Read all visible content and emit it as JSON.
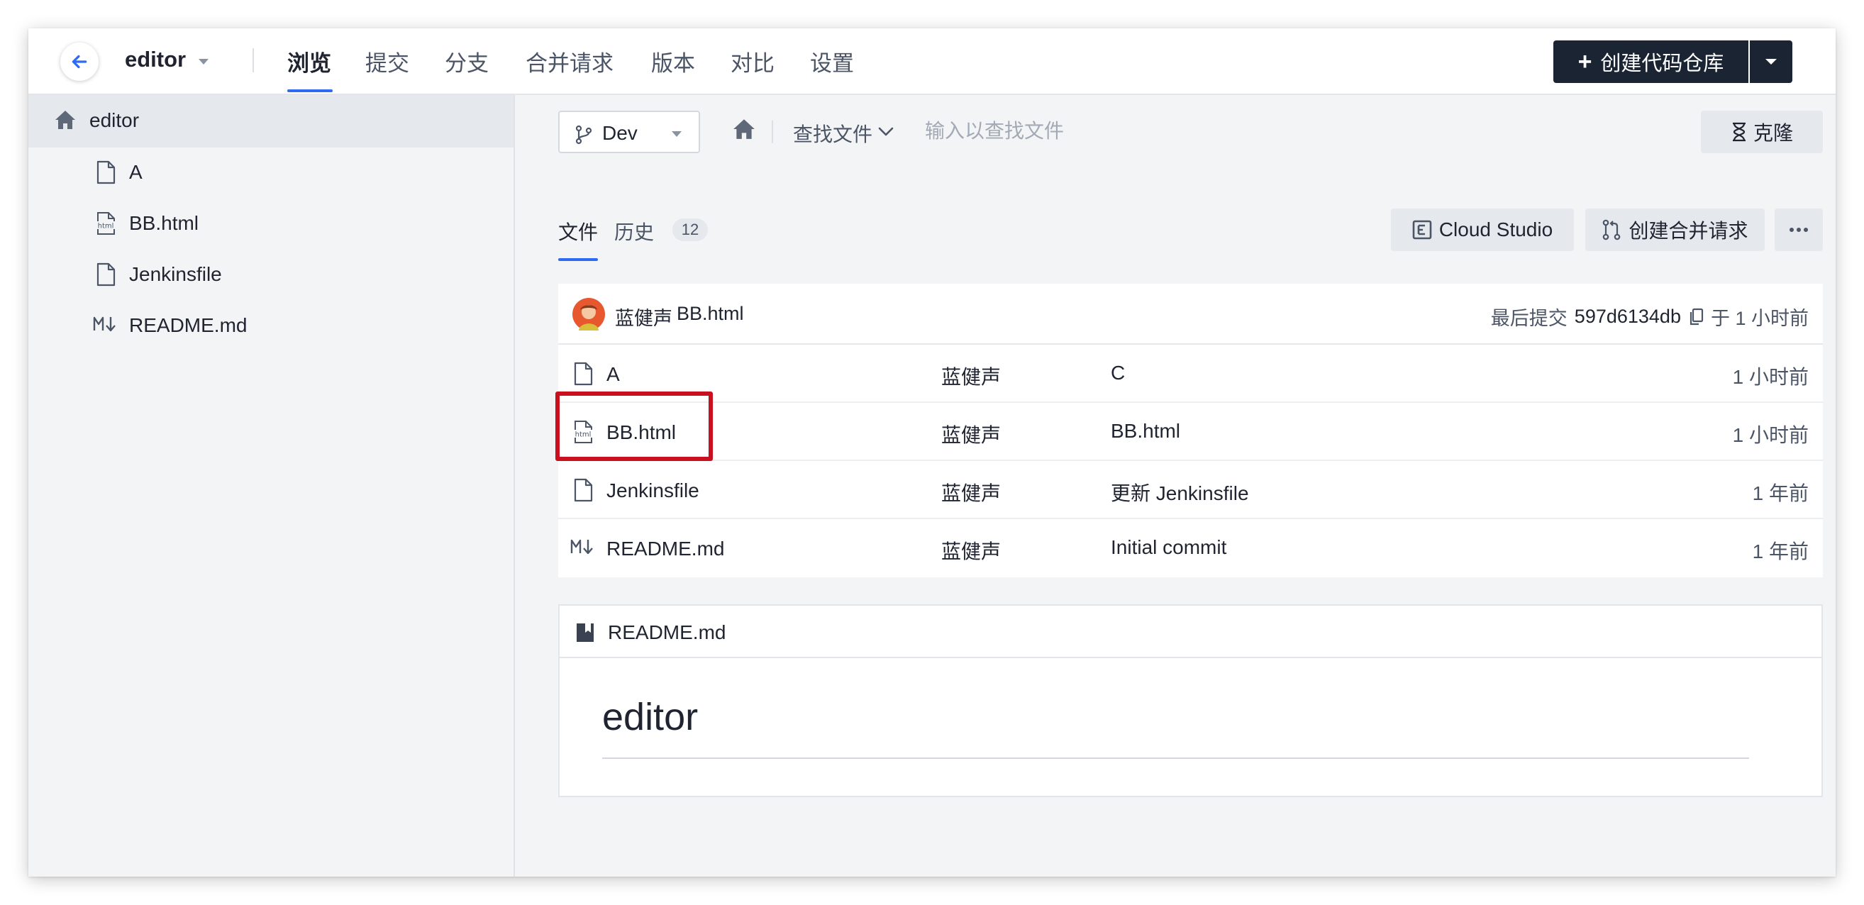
{
  "header": {
    "repo_name": "editor",
    "nav_tabs": [
      "浏览",
      "提交",
      "分支",
      "合并请求",
      "版本",
      "对比",
      "设置"
    ],
    "create_repo_label": "创建代码仓库"
  },
  "sidebar": {
    "root_label": "editor",
    "items": [
      {
        "label": "A",
        "icon": "file-icon"
      },
      {
        "label": "BB.html",
        "icon": "html-file-icon"
      },
      {
        "label": "Jenkinsfile",
        "icon": "file-icon"
      },
      {
        "label": "README.md",
        "icon": "markdown-icon"
      }
    ]
  },
  "toolbar": {
    "branch": "Dev",
    "find_label": "查找文件",
    "find_placeholder": "输入以查找文件",
    "clone_label": "克隆"
  },
  "tabs": {
    "files": "文件",
    "history": "历史",
    "history_count": "12"
  },
  "actions": {
    "cloud_studio": "Cloud Studio",
    "create_mr": "创建合并请求"
  },
  "last_commit": {
    "author": "蓝健声",
    "message": "BB.html",
    "label": "最后提交",
    "hash": "597d6134db",
    "time": "于 1 小时前"
  },
  "files": [
    {
      "name": "A",
      "author": "蓝健声",
      "message": "C",
      "time": "1 小时前"
    },
    {
      "name": "BB.html",
      "author": "蓝健声",
      "message": "BB.html",
      "time": "1 小时前"
    },
    {
      "name": "Jenkinsfile",
      "author": "蓝健声",
      "message": "更新 Jenkinsfile",
      "time": "1 年前"
    },
    {
      "name": "README.md",
      "author": "蓝健声",
      "message": "Initial commit",
      "time": "1 年前"
    }
  ],
  "readme": {
    "title": "README.md",
    "heading": "editor"
  },
  "colors": {
    "accent": "#2f6bf2",
    "dark_button": "#1b2433",
    "highlight": "#c8101e"
  }
}
